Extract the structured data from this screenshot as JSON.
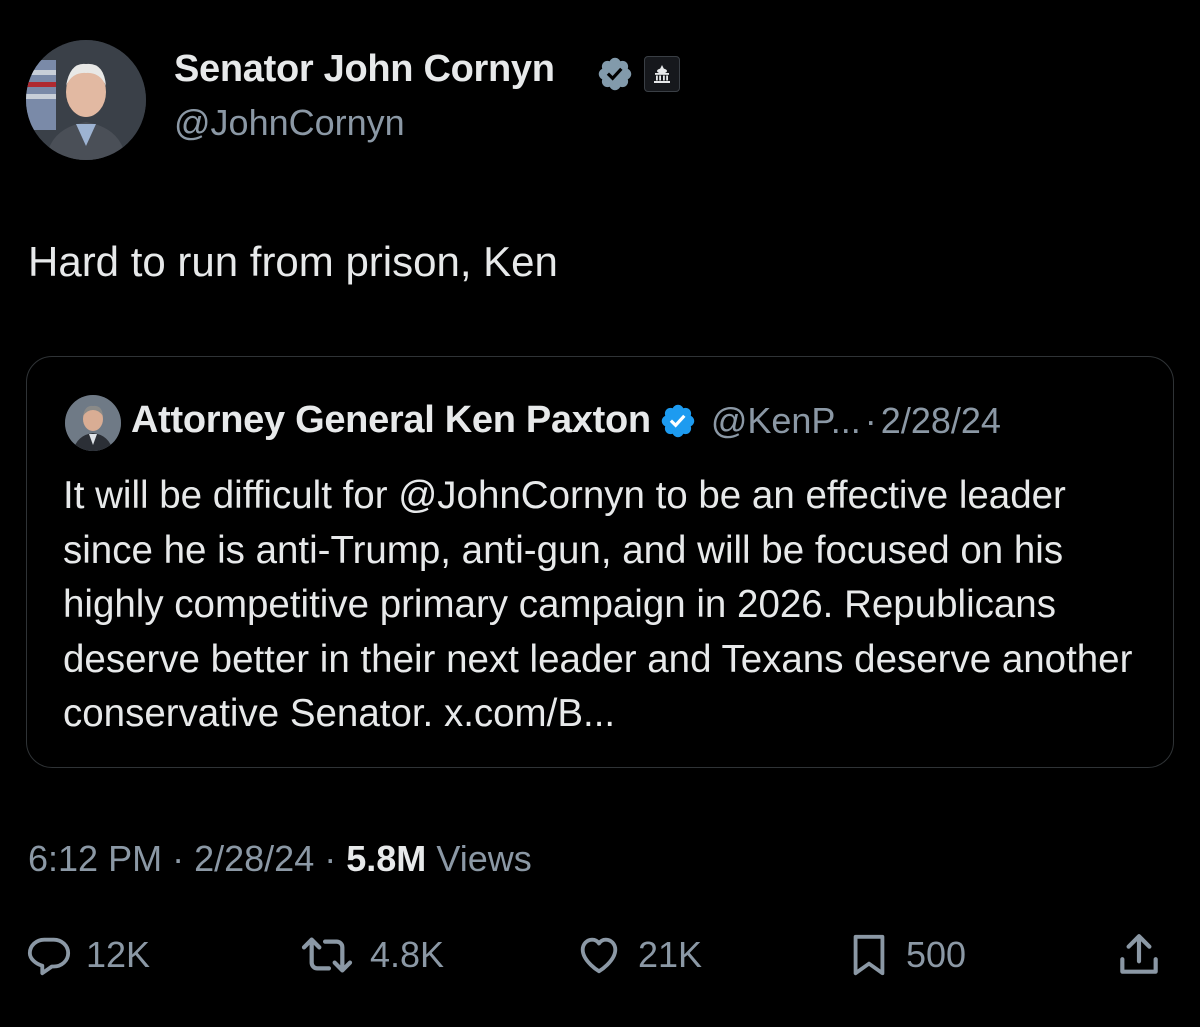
{
  "tweet": {
    "author": {
      "name": "Senator John Cornyn",
      "handle": "@JohnCornyn",
      "verified_color": "#829aab"
    },
    "text": "Hard to run from prison, Ken",
    "quoted": {
      "author_name": "Attorney General Ken Paxton",
      "handle": "@KenP...",
      "separator": "·",
      "date": "2/28/24",
      "verified_color": "#1d9bf0",
      "text": "It will be difficult for @JohnCornyn to be an effective leader since he is anti-Trump, anti-gun, and will be focused on his highly competitive primary campaign in 2026. Republicans deserve better in their next leader and Texans deserve another conservative Senator. x.com/B..."
    },
    "meta": {
      "time": "6:12 PM",
      "separator": "·",
      "date": "2/28/24",
      "views_count": "5.8M",
      "views_label": "Views"
    },
    "actions": {
      "replies": "12K",
      "reposts": "4.8K",
      "likes": "21K",
      "bookmarks": "500"
    },
    "icons": [
      "verified-icon",
      "government-badge-icon",
      "reply-icon",
      "repost-icon",
      "like-icon",
      "bookmark-icon",
      "share-icon"
    ]
  }
}
